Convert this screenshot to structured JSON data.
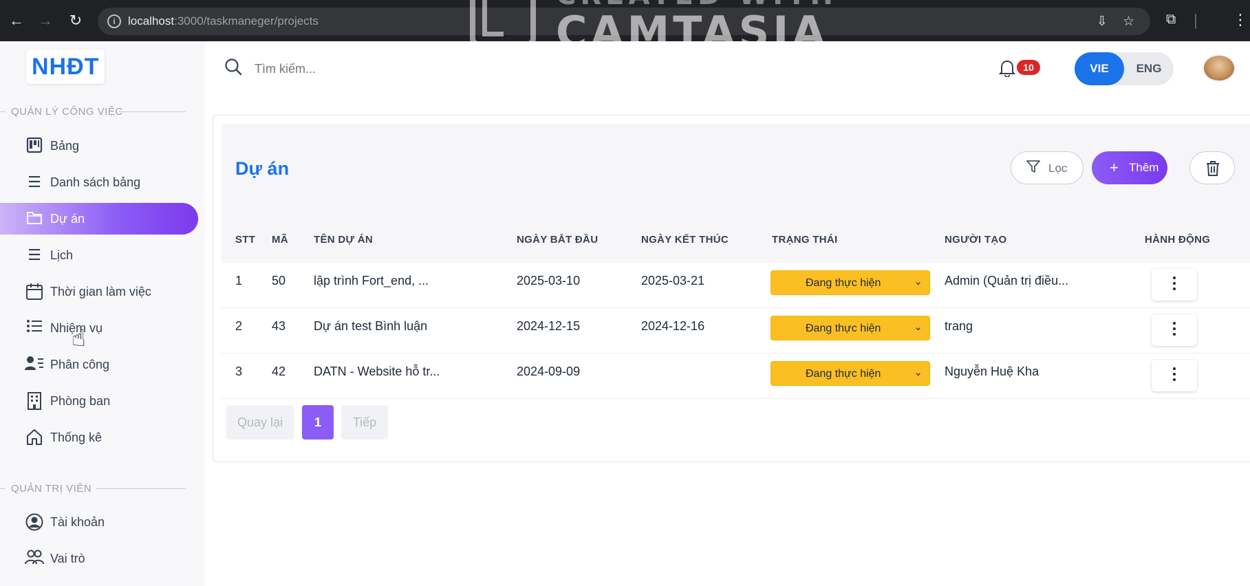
{
  "browser": {
    "url_host": "localhost",
    "url_rest": ":3000/taskmaneger/projects",
    "watermark": "CAMTASIA",
    "watermark_top": "CREATED WITH"
  },
  "app": {
    "logo": "NHĐT"
  },
  "sidebar": {
    "section_work": "QUẢN LÝ CÔNG VIỆC",
    "section_admin": "QUẢN TRỊ VIÊN",
    "items": [
      {
        "label": "Bảng",
        "icon": "board-icon"
      },
      {
        "label": "Danh sách bảng",
        "icon": "list-icon"
      },
      {
        "label": "Dự án",
        "icon": "folder-icon",
        "active": true
      },
      {
        "label": "Lịch",
        "icon": "list-icon"
      },
      {
        "label": "Thời gian làm việc",
        "icon": "calendar-icon"
      },
      {
        "label": "Nhiệm vụ",
        "icon": "task-list-icon"
      },
      {
        "label": "Phân công",
        "icon": "assign-icon"
      },
      {
        "label": "Phòng ban",
        "icon": "building-icon"
      },
      {
        "label": "Thống kê",
        "icon": "home-icon"
      }
    ],
    "admin_items": [
      {
        "label": "Tài khoản",
        "icon": "account-icon"
      },
      {
        "label": "Vai trò",
        "icon": "users-icon"
      }
    ]
  },
  "header": {
    "search_placeholder": "Tìm kiếm...",
    "notification_count": "10",
    "lang_vie": "VIE",
    "lang_eng": "ENG",
    "active_lang": "VIE"
  },
  "page": {
    "title": "Dự án",
    "filter_label": "Lọc",
    "add_label": "Thêm"
  },
  "table": {
    "headers": [
      "STT",
      "MÃ",
      "TÊN DỰ ÁN",
      "NGÀY BẮT ĐẦU",
      "NGÀY KẾT THÚC",
      "TRẠNG THÁI",
      "NGƯỜI TẠO",
      "HÀNH ĐỘNG"
    ],
    "rows": [
      {
        "stt": "1",
        "ma": "50",
        "ten": "lập trình Fort_end, ...",
        "bat_dau": "2025-03-10",
        "ket_thuc": "2025-03-21",
        "trang_thai": "Đang thực hiện",
        "nguoi_tao": "Admin (Quản trị điều..."
      },
      {
        "stt": "2",
        "ma": "43",
        "ten": "Dự án test Bình luận",
        "bat_dau": "2024-12-15",
        "ket_thuc": "2024-12-16",
        "trang_thai": "Đang thực hiện",
        "nguoi_tao": "trang"
      },
      {
        "stt": "3",
        "ma": "42",
        "ten": "DATN - Website hỗ tr...",
        "bat_dau": "2024-09-09",
        "ket_thuc": "",
        "trang_thai": "Đang thực hiện",
        "nguoi_tao": "Nguyễn Huệ Kha"
      }
    ]
  },
  "pagination": {
    "prev": "Quay lại",
    "current": "1",
    "next": "Tiếp"
  },
  "colors": {
    "accent": "#8b5cf6",
    "primary": "#1a73e8",
    "status": "#fbbf24",
    "badge": "#dc2626"
  }
}
